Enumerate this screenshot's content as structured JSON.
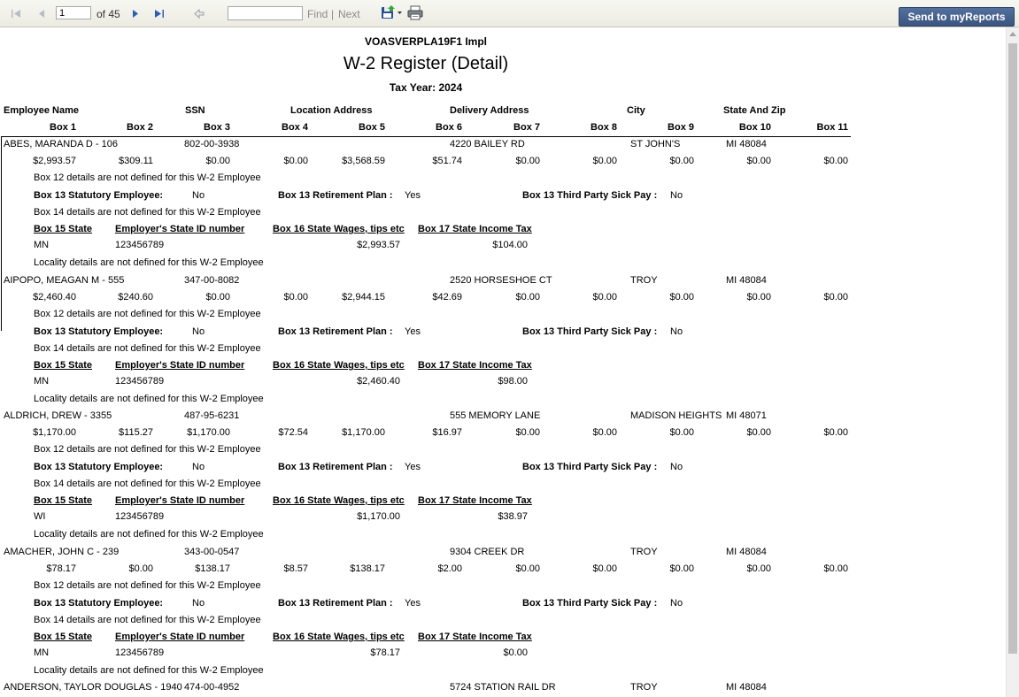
{
  "toolbar": {
    "page_value": "1",
    "of_pages": "of 45",
    "find_placeholder": "",
    "find_label": "Find",
    "separator": "|",
    "next_label": "Next",
    "send_label": "Send to myReports"
  },
  "report": {
    "company": "VOASVERPLA19F1 Impl",
    "title": "W-2 Register (Detail)",
    "tax_year": "Tax Year: 2024",
    "header_row1": [
      "Employee Name",
      "SSN",
      "Location Address",
      "Delivery Address",
      "City",
      "State And Zip"
    ],
    "header_row2": [
      "Box 1",
      "Box 2",
      "Box 3",
      "Box 4",
      "Box 5",
      "Box 6",
      "Box 7",
      "Box 8",
      "Box 9",
      "Box 10",
      "Box 11"
    ],
    "labels": {
      "box12": "Box 12 details are not defined for this W-2 Employee",
      "statutory": "Box 13 Statutory  Employee:",
      "retirement": "Box 13 Retirement Plan :",
      "sick_pay": "Box 13 Third Party Sick Pay :",
      "box14": "Box 14 details are not defined for this W-2 Employee",
      "state_col": "Box 15 State",
      "state_id_col": "Employer's State ID number",
      "state_wages_col": "Box 16 State Wages, tips etc",
      "state_tax_col": "Box 17 State Income Tax",
      "locality": "Locality details are not defined for this W-2 Employee"
    },
    "employees": [
      {
        "name": "ABES, MARANDA D - 106",
        "ssn": "802-00-3938",
        "delivery": "4220 BAILEY RD",
        "city": "ST JOHN'S",
        "state_zip": "MI 48084",
        "boxes": [
          "$2,993.57",
          "$309.11",
          "$0.00",
          "$0.00",
          "$3,568.59",
          "$51.74",
          "$0.00",
          "$0.00",
          "$0.00",
          "$0.00",
          "$0.00"
        ],
        "statutory": "No",
        "retirement": "Yes",
        "sick_pay": "No",
        "state": "MN",
        "state_id": "123456789",
        "state_wages": "$2,993.57",
        "state_tax": "$104.00"
      },
      {
        "name": "AIPOPO, MEAGAN M - 555",
        "ssn": "347-00-8082",
        "delivery": "2520 HORSESHOE CT",
        "city": "TROY",
        "state_zip": "MI 48084",
        "boxes": [
          "$2,460.40",
          "$240.60",
          "$0.00",
          "$0.00",
          "$2,944.15",
          "$42.69",
          "$0.00",
          "$0.00",
          "$0.00",
          "$0.00",
          "$0.00"
        ],
        "statutory": "No",
        "retirement": "Yes",
        "sick_pay": "No",
        "state": "MN",
        "state_id": "123456789",
        "state_wages": "$2,460.40",
        "state_tax": "$98.00"
      },
      {
        "name": "ALDRICH, DREW - 3355",
        "ssn": "487-95-6231",
        "delivery": "555 MEMORY LANE",
        "city": "MADISON HEIGHTS",
        "state_zip": "MI 48071",
        "boxes": [
          "$1,170.00",
          "$115.27",
          "$1,170.00",
          "$72.54",
          "$1,170.00",
          "$16.97",
          "$0.00",
          "$0.00",
          "$0.00",
          "$0.00",
          "$0.00"
        ],
        "statutory": "No",
        "retirement": "Yes",
        "sick_pay": "No",
        "state": "WI",
        "state_id": "123456789",
        "state_wages": "$1,170.00",
        "state_tax": "$38.97"
      },
      {
        "name": "AMACHER, JOHN C - 239",
        "ssn": "343-00-0547",
        "delivery": "9304 CREEK DR",
        "city": "TROY",
        "state_zip": "MI 48084",
        "boxes": [
          "$78.17",
          "$0.00",
          "$138.17",
          "$8.57",
          "$138.17",
          "$2.00",
          "$0.00",
          "$0.00",
          "$0.00",
          "$0.00",
          "$0.00"
        ],
        "statutory": "No",
        "retirement": "Yes",
        "sick_pay": "No",
        "state": "MN",
        "state_id": "123456789",
        "state_wages": "$78.17",
        "state_tax": "$0.00"
      },
      {
        "name": "ANDERSON, TAYLOR DOUGLAS - 1940",
        "ssn": "474-00-4952",
        "delivery": "5724 STATION RAIL DR",
        "city": "TROY",
        "state_zip": "MI 48084"
      }
    ]
  }
}
